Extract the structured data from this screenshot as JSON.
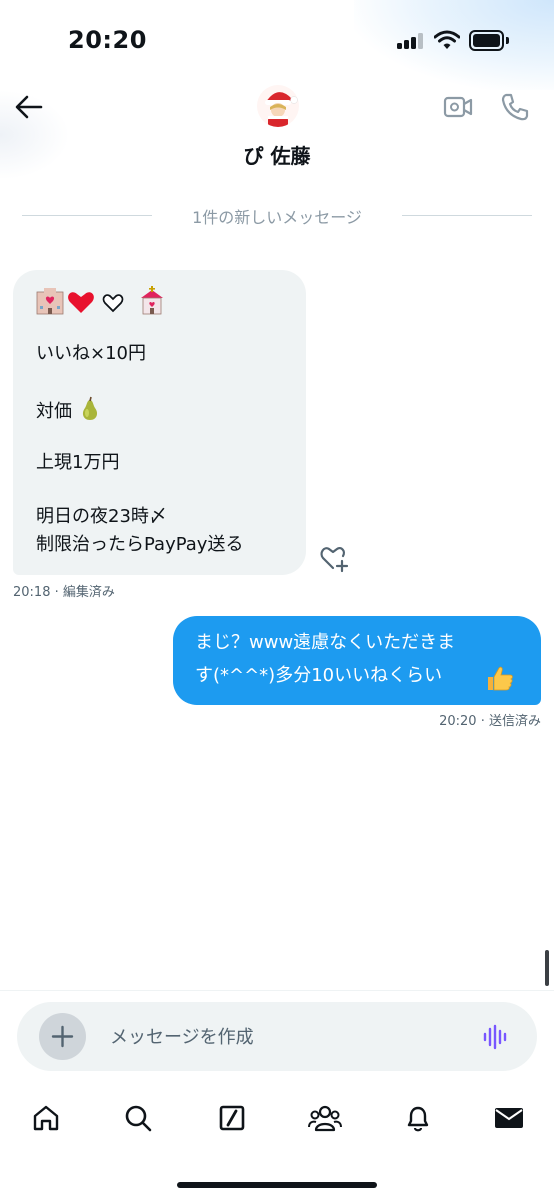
{
  "status_bar": {
    "time": "20:20"
  },
  "header": {
    "contact_name": "ぴ 佐藤"
  },
  "divider": {
    "label": "1件の新しいメッセージ"
  },
  "incoming_message": {
    "lines": [
      "いいね×10円",
      "対価",
      "上現1万円",
      "明日の夜23時〆",
      "制限治ったらPayPay送る"
    ],
    "time": "20:18",
    "status": "編集済み"
  },
  "outgoing_message": {
    "lines": [
      "まじ？www遠慮なくいただきま",
      "す(*^^*)多分10いいねくらい"
    ],
    "time": "20:20",
    "status": "送信済み"
  },
  "composer": {
    "placeholder": "メッセージを作成"
  },
  "icons": {
    "back": "arrow-left-icon",
    "video": "video-camera-icon",
    "phone": "phone-icon",
    "heart_add": "heart-plus-icon",
    "plus": "plus-icon",
    "voice": "voice-wave-icon",
    "home": "home-icon",
    "search": "search-icon",
    "grok": "slash-box-icon",
    "communities": "people-icon",
    "notifications": "bell-icon",
    "messages": "envelope-icon"
  },
  "colors": {
    "accent": "#1d9bf0",
    "voice": "#7856ff",
    "incoming_bubble": "#eff3f4",
    "text": "#0f1419",
    "muted": "#536471"
  }
}
